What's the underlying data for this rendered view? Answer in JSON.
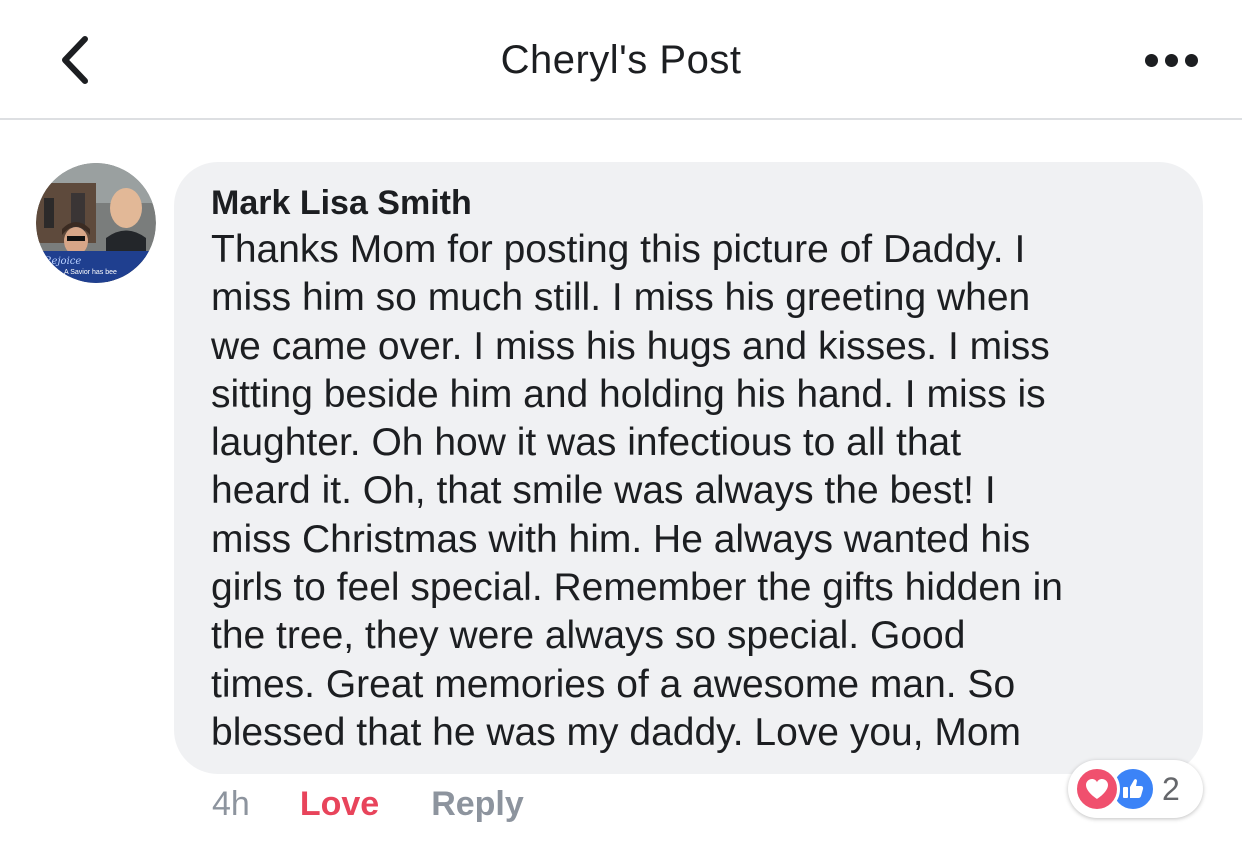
{
  "header": {
    "title": "Cheryl's Post",
    "back_icon": "chevron-left-icon",
    "more_icon": "more-horizontal-icon"
  },
  "comment": {
    "author": "Mark Lisa Smith",
    "avatar_caption_1": "Rejoice",
    "avatar_caption_2": "A Savior has bee",
    "text": "Thanks Mom for posting this picture of Daddy. I\nmiss him so much still. I miss his greeting when\nwe came over. I miss his hugs and kisses. I miss\nsitting beside him and holding his  hand. I miss is\nlaughter. Oh how it was infectious to all that\nheard it. Oh, that smile was always the best!  I\nmiss Christmas with him.  He always wanted his\ngirls to feel special. Remember the gifts hidden in\nthe tree, they were always so special.  Good\ntimes. Great memories of a awesome man. So\nblessed that he was my daddy. Love you, Mom",
    "time": "4h",
    "love_label": "Love",
    "reply_label": "Reply",
    "reaction_count": "2",
    "reaction_icons": [
      "heart-icon",
      "thumbs-up-icon"
    ]
  },
  "colors": {
    "love": "#e8445b",
    "like": "#3b83f7",
    "bubble": "#f0f1f3",
    "muted": "#8d949e"
  }
}
